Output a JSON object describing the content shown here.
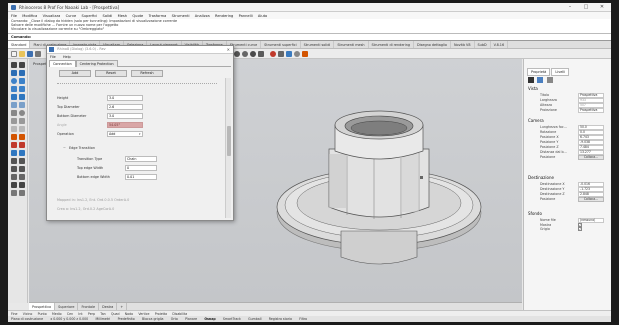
{
  "window": {
    "title": "Rhinoceros 8 Prof For Naoaki Lab - [Prospettiva]",
    "controls": [
      "–",
      "□",
      "✕"
    ]
  },
  "menu": [
    "File",
    "Modifica",
    "Visualizza",
    "Curve",
    "Superfici",
    "Solidi",
    "Mesh",
    "Quote",
    "Trasforma",
    "Strumenti",
    "Analizza",
    "Rendering",
    "Pannelli",
    "Aiuto"
  ],
  "command_history": [
    "Comando: _Close il dialog da hidden (solo per tunneling): Impostazioni di visualizzazione corrente",
    "Salvare delle modifiche ... Fornire un nuovo nome per l'oggetto",
    "Vincolare la visualizzazione corrente su \"Ombreggiato\""
  ],
  "command_prompt": "Comando:",
  "toolbar_tabs": [
    "Standard",
    "Piani di costruzione",
    "Imposta vista",
    "Visualizza",
    "Seleziona",
    "Layout viewport",
    "Visibilità",
    "Trasforma",
    "Strumenti curve",
    "Strumenti superfici",
    "Strumenti solidi",
    "Strumenti mesh",
    "Strumenti di rendering",
    "Disegno dettaglio",
    "Novità V8",
    "SubD",
    "V.8.16"
  ],
  "viewport": {
    "label": "Prospettiva",
    "tabs": [
      "Prospettiva",
      "Superiore",
      "Frontale",
      "Destra",
      "+"
    ],
    "active_tab": "Prospettiva"
  },
  "osnaps": [
    "Fine",
    "Vicino",
    "Punto",
    "Medio",
    "Cen",
    "Int",
    "Perp",
    "Tan",
    "Quad",
    "Nodo",
    "Vertice",
    "Proietta",
    "Disabilita"
  ],
  "status_bar": {
    "cplane": "Piano di costruzione",
    "coords": "x 0.000  y 0.000  z 0.000",
    "units": "Millimetri",
    "layer": "Predefinito",
    "toggles": [
      "Blocca griglia",
      "Orto",
      "Planare",
      "Osnap",
      "SmartTrack",
      "Gumball",
      "Registra storia",
      "Filtro"
    ],
    "bold_toggle": "Osnap"
  },
  "right_panel": {
    "tabs": [
      "Proprietà",
      "Livelli"
    ],
    "vista_header": "Vista",
    "vista_rows": [
      {
        "label": "Titolo",
        "value": "Prospettiva"
      },
      {
        "label": "Larghezza",
        "value": "933"
      },
      {
        "label": "Altezza",
        "value": "507"
      },
      {
        "label": "Proiezione",
        "value": "Prospettiva"
      }
    ],
    "camera_header": "Camera",
    "camera_rows": [
      {
        "label": "Lunghezza foc...",
        "value": "50.0"
      },
      {
        "label": "Rotazione",
        "value": "0.0"
      },
      {
        "label": "Posizione X",
        "value": "6.743"
      },
      {
        "label": "Posizione Y",
        "value": "-9.038"
      },
      {
        "label": "Posizione Z",
        "value": "7.484"
      },
      {
        "label": "Distanza dal b...",
        "value": "13.277"
      }
    ],
    "camera_button_label": "Posizione",
    "camera_button": "Colloca...",
    "target_header": "Destinazione",
    "target_rows": [
      {
        "label": "Destinazione X",
        "value": "-0.016"
      },
      {
        "label": "Destinazione Y",
        "value": "-1.723"
      },
      {
        "label": "Destinazione Z",
        "value": "2.848"
      }
    ],
    "target_button_label": "Posizione",
    "target_button": "Colloca...",
    "sfondo_header": "Sfondo",
    "sfondo_rows": [
      {
        "label": "Nome file",
        "value": "(nessuno)"
      },
      {
        "label": "Mostra",
        "checked": true
      },
      {
        "label": "Grigio",
        "checked": true
      }
    ]
  },
  "dialog": {
    "title": "Rhino8 (Dialog) (3.6.0) - Rev",
    "menu": [
      "File",
      "Help"
    ],
    "tabs": [
      "Connection",
      "Centering Protection"
    ],
    "active_tab": "Connection",
    "buttons": [
      "Add",
      "Reset",
      "Refresh"
    ],
    "fields": [
      {
        "label": "Height",
        "value": "3.0"
      },
      {
        "label": "Top Diameter",
        "value": "2.6"
      },
      {
        "label": "Bottom Diameter",
        "value": "3.0"
      },
      {
        "label": "Angle",
        "value": "54.05°"
      },
      {
        "label": "Operation",
        "value": "Add"
      }
    ],
    "edge_section": "Edge Transition",
    "edge_fields": [
      {
        "label": "Transition Type",
        "value": "Chain"
      },
      {
        "label": "Top edge Width",
        "value": "0"
      },
      {
        "label": "Bottom edge Width",
        "value": "0.01"
      }
    ],
    "footer_lines": [
      "Mapped in: Ins1.2, Ent. Ord.0.0.5 OrderA.0",
      "Crea a: Ins1.2, Ord.0.2 AgeCorA.0"
    ]
  },
  "colors": {
    "viewport_bg": "#c8cacd",
    "object_fill": "#d9d9d9",
    "object_edge": "#555555",
    "accent": "#2d6cb5"
  }
}
